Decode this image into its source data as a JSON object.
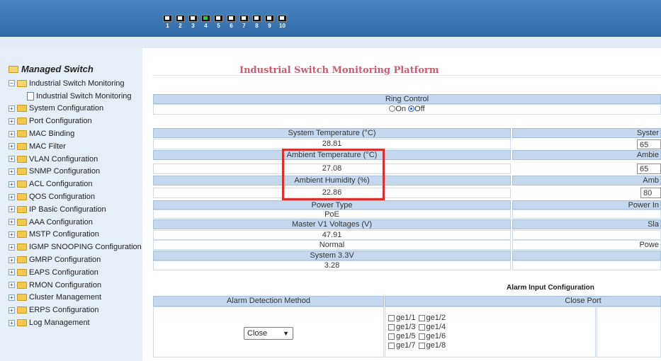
{
  "topbar": {
    "ports": [
      {
        "num": "1",
        "active": false
      },
      {
        "num": "2",
        "active": false
      },
      {
        "num": "3",
        "active": false
      },
      {
        "num": "4",
        "active": true
      },
      {
        "num": "5",
        "active": false
      },
      {
        "num": "6",
        "active": false
      },
      {
        "num": "7",
        "active": false
      },
      {
        "num": "8",
        "active": false
      },
      {
        "num": "9",
        "active": false
      },
      {
        "num": "10",
        "active": false
      }
    ]
  },
  "sidebar": {
    "root": "Managed Switch",
    "items": [
      {
        "label": "Industrial Switch Monitoring",
        "open": true
      },
      {
        "label": "Industrial Switch Monitoring",
        "sub": true
      },
      {
        "label": "System Configuration"
      },
      {
        "label": "Port Configuration"
      },
      {
        "label": "MAC Binding"
      },
      {
        "label": "MAC Filter"
      },
      {
        "label": "VLAN Configuration"
      },
      {
        "label": "SNMP Configuration"
      },
      {
        "label": "ACL Configuration"
      },
      {
        "label": "QOS Configuration"
      },
      {
        "label": "IP Basic Configuration"
      },
      {
        "label": "AAA Configuration"
      },
      {
        "label": "MSTP Configuration"
      },
      {
        "label": "IGMP SNOOPING Configuration"
      },
      {
        "label": "GMRP Configuration"
      },
      {
        "label": "EAPS Configuration"
      },
      {
        "label": "RMON Configuration"
      },
      {
        "label": "Cluster Management"
      },
      {
        "label": "ERPS Configuration"
      },
      {
        "label": "Log Management"
      }
    ]
  },
  "main": {
    "title": "Industrial Switch Monitoring Platform",
    "ring_control": {
      "label": "Ring Control",
      "on_label": "On",
      "off_label": "Off",
      "selected": "Off"
    },
    "sys_temp": {
      "label": "System Temperature (°C)",
      "value": "28.81"
    },
    "sys_temp_right": {
      "label": "Syster",
      "value": "65"
    },
    "amb_temp": {
      "label": "Ambient Temperature (°C)",
      "value": "27.08"
    },
    "amb_temp_right": {
      "label": "Ambie",
      "value": "65"
    },
    "amb_hum": {
      "label": "Ambient Humidity (%)",
      "value": "22.86"
    },
    "amb_hum_right": {
      "label": "Amb",
      "value": "80"
    },
    "power_type": {
      "label": "Power Type",
      "value": "PoE"
    },
    "power_type_right": {
      "label": "Power In"
    },
    "master_v1": {
      "label": "Master V1 Voltages (V)",
      "value": "47.91"
    },
    "master_v1_right": {
      "label": "Sla"
    },
    "normal": {
      "value": "Normal"
    },
    "normal_right": {
      "value": "Powe"
    },
    "sys33": {
      "label": "System 3.3V",
      "value": "3.28"
    },
    "alarm": {
      "title": "Alarm Input Configuration",
      "col_method": "Alarm Detection Method",
      "col_close": "Close Port",
      "select_value": "Close",
      "ports": [
        "ge1/1",
        "ge1/2",
        "ge1/3",
        "ge1/4",
        "ge1/5",
        "ge1/6",
        "ge1/7",
        "ge1/8"
      ]
    }
  },
  "colors": {
    "accent_title": "#c45d6f",
    "highlight": "#d9302b",
    "header_bg": "#c5d8ee",
    "topbar": "#3b78b5"
  }
}
